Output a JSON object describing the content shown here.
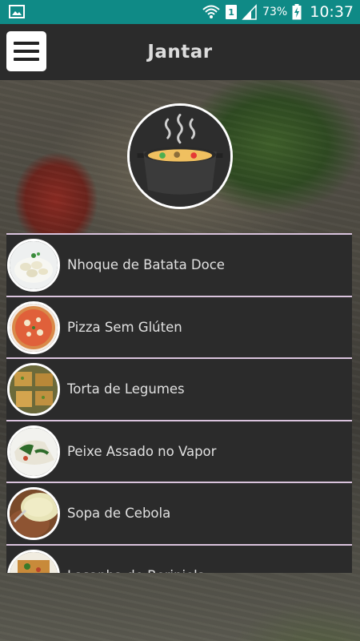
{
  "status_bar": {
    "sim_slot": "1",
    "battery_percent": "73%",
    "time": "10:37",
    "icons": [
      "image-notification-icon",
      "wifi-icon",
      "sim-icon",
      "signal-icon",
      "battery-charging-icon"
    ]
  },
  "app_bar": {
    "title": "Jantar",
    "menu_icon": "hamburger-menu-icon"
  },
  "logo": {
    "icon": "steaming-pot-icon"
  },
  "recipes": [
    {
      "name": "Nhoque de Batata Doce",
      "thumb": "gnocchi"
    },
    {
      "name": "Pizza Sem Glúten",
      "thumb": "pizza"
    },
    {
      "name": "Torta de Legumes",
      "thumb": "pie"
    },
    {
      "name": "Peixe Assado no Vapor",
      "thumb": "fish"
    },
    {
      "name": "Sopa de Cebola",
      "thumb": "soup"
    },
    {
      "name": "Lasanha de Berinjela",
      "thumb": "lasagna"
    }
  ],
  "colors": {
    "status_bar": "#0f8a86",
    "app_bar": "#2b2b2b",
    "divider": "#d9c3dd",
    "text": "#e0e0e0"
  }
}
